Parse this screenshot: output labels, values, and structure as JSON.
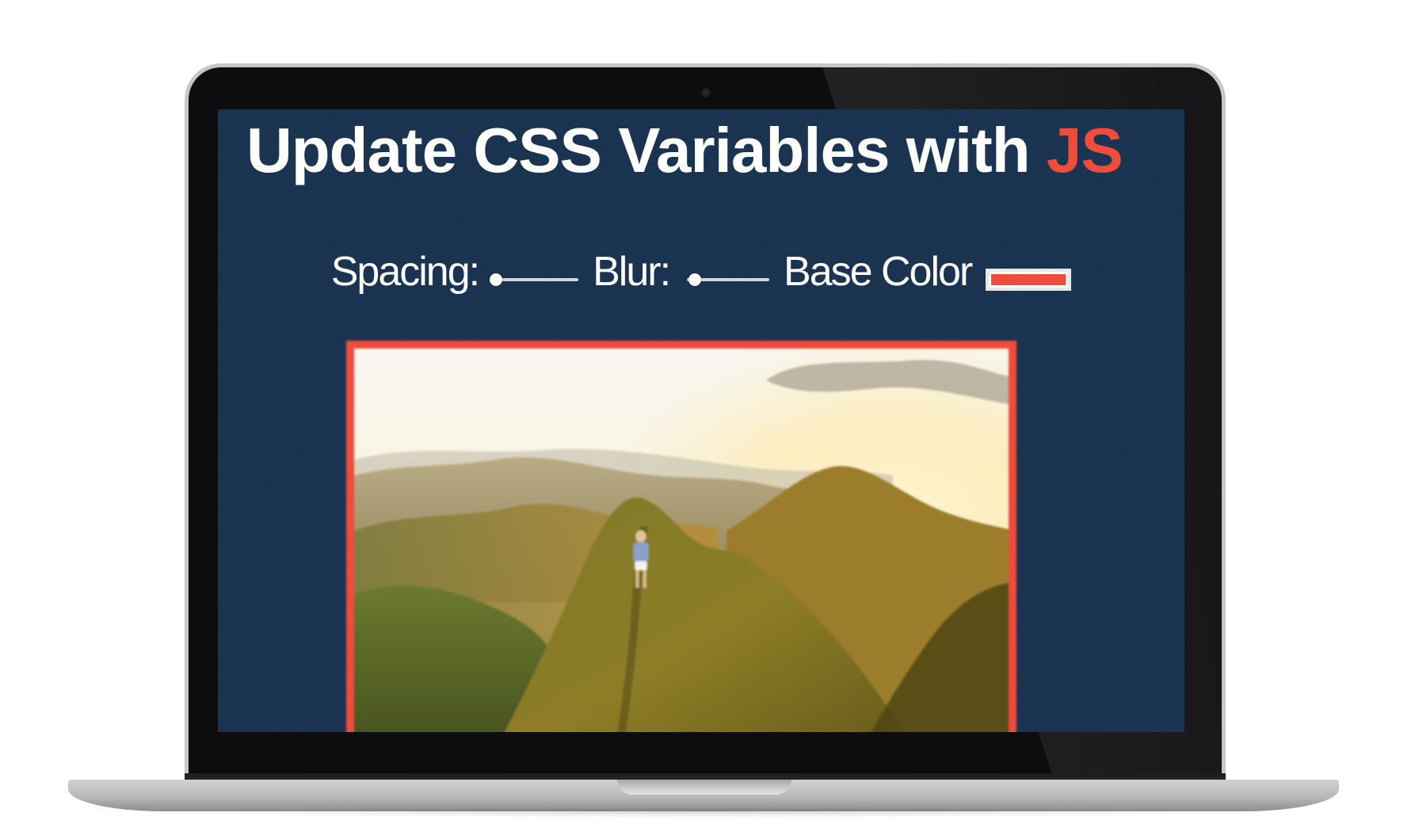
{
  "title": {
    "main": "Update CSS Variables with ",
    "accent": "JS"
  },
  "controls": {
    "spacing": {
      "label": "Spacing:",
      "value": 0
    },
    "blur": {
      "label": "Blur:",
      "value": 0.1
    },
    "base_color": {
      "label": "Base Color",
      "value": "#ef4c3c"
    }
  },
  "photo": {
    "icon": "mountain-ridge-hiker-photo"
  },
  "colors": {
    "background": "#193351",
    "accent": "#ef4c3c",
    "text": "#ffffff"
  }
}
